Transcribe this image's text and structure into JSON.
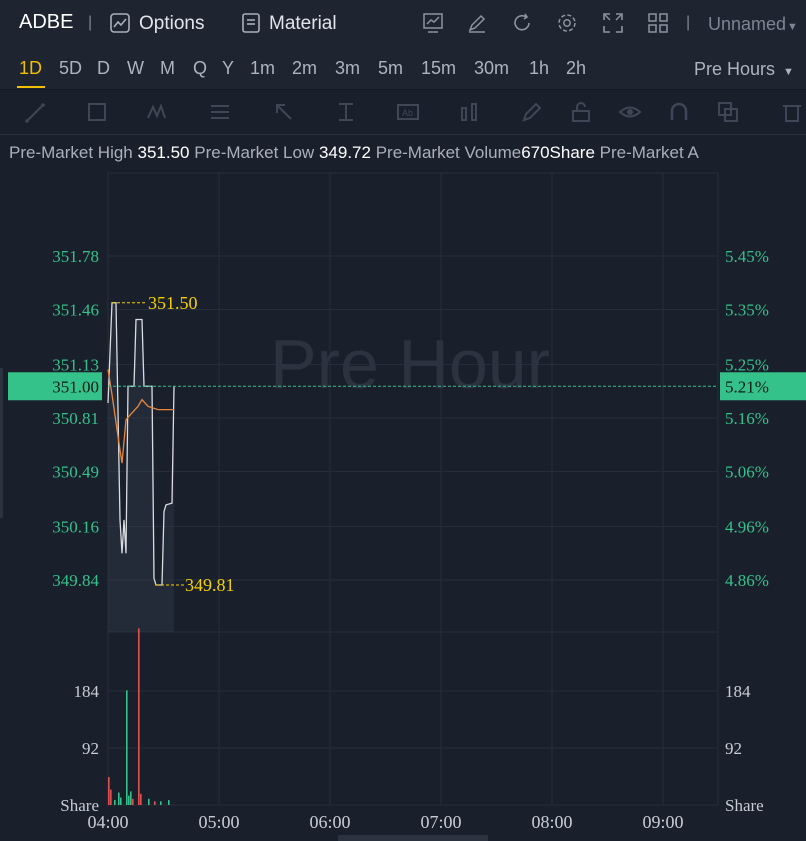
{
  "header": {
    "symbol": "ADBE",
    "separator": "|",
    "options_label": "Options",
    "material_label": "Material",
    "layout_name": "Unnamed",
    "icons": [
      "options-icon",
      "material-icon",
      "indicator-icon",
      "draw-icon",
      "refresh-icon",
      "settings-icon",
      "fullscreen-icon",
      "layout-grid-icon",
      "chevron-down-icon"
    ]
  },
  "intervals": [
    "1D",
    "5D",
    "D",
    "W",
    "M",
    "Q",
    "Y",
    "1m",
    "2m",
    "3m",
    "5m",
    "15m",
    "30m",
    "1h",
    "2h"
  ],
  "active_interval": "1D",
  "session_select": "Pre Hours",
  "info": {
    "high_label": "Pre-Market High",
    "high_value": "351.50",
    "low_label": "Pre-Market Low",
    "low_value": "349.72",
    "volume_label": "Pre-Market Volume",
    "volume_value": "670Share",
    "avg_label": "Pre-Market A"
  },
  "watermark": "Pre Hour",
  "colors": {
    "up": "#35c18a",
    "down": "#e05252",
    "highlight": "#f5d000",
    "avg_line": "#e8873a",
    "accent": "#f0c000"
  },
  "chart_data": {
    "type": "line",
    "price_axis_left": [
      "351.78",
      "351.46",
      "351.13",
      "350.81",
      "350.49",
      "350.16",
      "349.84"
    ],
    "percent_axis_right": [
      "5.45%",
      "5.35%",
      "5.25%",
      "5.16%",
      "5.06%",
      "4.96%",
      "4.86%"
    ],
    "current_price": "351.00",
    "current_percent": "5.21%",
    "high_marker": "351.50",
    "low_marker": "349.81",
    "volume_axis": [
      "184",
      "92",
      "Share"
    ],
    "x_ticks": [
      "04:00",
      "05:00",
      "06:00",
      "07:00",
      "08:00",
      "09:00"
    ],
    "price_series": [
      {
        "t": 0,
        "p": 350.9
      },
      {
        "t": 2,
        "p": 351.5
      },
      {
        "t": 4,
        "p": 351.5
      },
      {
        "t": 6,
        "p": 350.2
      },
      {
        "t": 7,
        "p": 350.0
      },
      {
        "t": 8,
        "p": 350.2
      },
      {
        "t": 9,
        "p": 350.0
      },
      {
        "t": 10,
        "p": 351.0
      },
      {
        "t": 13,
        "p": 351.0
      },
      {
        "t": 14,
        "p": 351.4
      },
      {
        "t": 17,
        "p": 351.4
      },
      {
        "t": 18,
        "p": 351.0
      },
      {
        "t": 22,
        "p": 351.0
      },
      {
        "t": 23,
        "p": 349.85
      },
      {
        "t": 24,
        "p": 349.81
      },
      {
        "t": 27,
        "p": 349.81
      },
      {
        "t": 28,
        "p": 350.25
      },
      {
        "t": 29,
        "p": 350.29
      },
      {
        "t": 32,
        "p": 350.3
      },
      {
        "t": 33,
        "p": 351.0
      }
    ],
    "avg_series": [
      {
        "t": 0,
        "p": 351.1
      },
      {
        "t": 2,
        "p": 350.95
      },
      {
        "t": 5,
        "p": 350.7
      },
      {
        "t": 7,
        "p": 350.54
      },
      {
        "t": 9,
        "p": 350.8
      },
      {
        "t": 12,
        "p": 350.84
      },
      {
        "t": 15,
        "p": 350.88
      },
      {
        "t": 17,
        "p": 350.92
      },
      {
        "t": 20,
        "p": 350.88
      },
      {
        "t": 25,
        "p": 350.86
      },
      {
        "t": 33,
        "p": 350.86
      }
    ],
    "volume_bars": [
      {
        "t": 0,
        "v": 45,
        "up": false
      },
      {
        "t": 1,
        "v": 25,
        "up": false
      },
      {
        "t": 3,
        "v": 8,
        "up": true
      },
      {
        "t": 5,
        "v": 20,
        "up": true
      },
      {
        "t": 6,
        "v": 12,
        "up": true
      },
      {
        "t": 9,
        "v": 185,
        "up": true
      },
      {
        "t": 10,
        "v": 15,
        "up": true
      },
      {
        "t": 11,
        "v": 22,
        "up": true
      },
      {
        "t": 12,
        "v": 10,
        "up": false
      },
      {
        "t": 15,
        "v": 285,
        "up": false
      },
      {
        "t": 16,
        "v": 18,
        "up": false
      },
      {
        "t": 20,
        "v": 10,
        "up": true
      },
      {
        "t": 23,
        "v": 6,
        "up": false
      },
      {
        "t": 26,
        "v": 6,
        "up": true
      },
      {
        "t": 30,
        "v": 8,
        "up": true
      }
    ]
  }
}
